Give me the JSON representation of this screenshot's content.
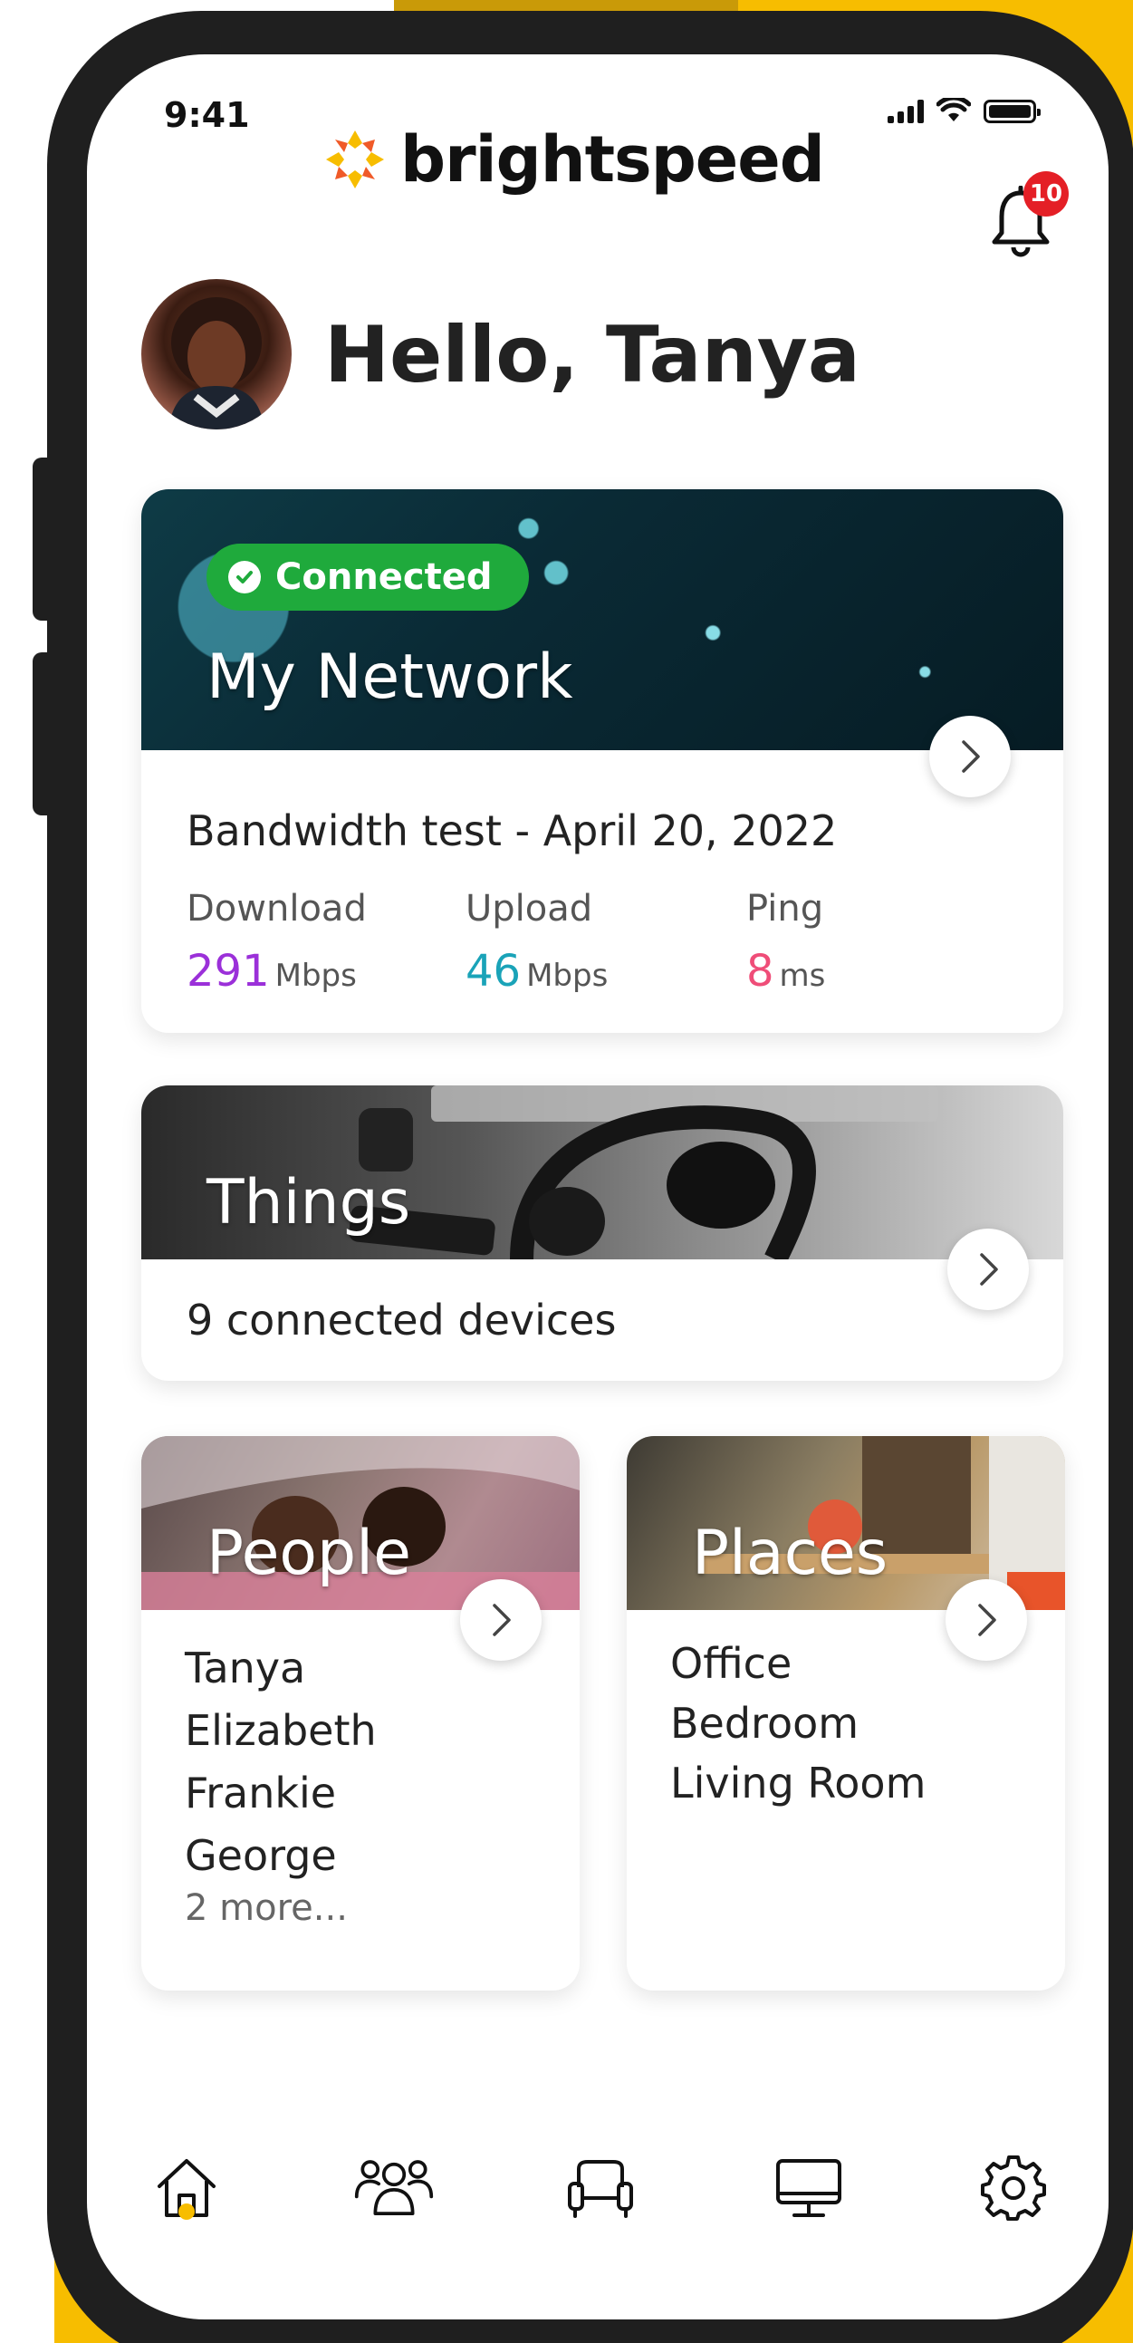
{
  "status_bar": {
    "time": "9:41"
  },
  "brand": {
    "name": "brightspeed",
    "colors": {
      "accent": "#f7bd00",
      "logo_red": "#f05a28"
    }
  },
  "notifications": {
    "count": "10",
    "icon": "bell-icon"
  },
  "greeting": {
    "text": "Hello, Tanya"
  },
  "network_card": {
    "status": "Connected",
    "title": "My Network",
    "test_title": "Bandwidth test - April 20, 2022",
    "stats": [
      {
        "label": "Download",
        "value": "291",
        "unit": "Mbps",
        "color": "#9b30d9"
      },
      {
        "label": "Upload",
        "value": "46",
        "unit": "Mbps",
        "color": "#1aa3b8"
      },
      {
        "label": "Ping",
        "value": "8",
        "unit": "ms",
        "color": "#ef4d78"
      }
    ]
  },
  "things_card": {
    "title": "Things",
    "subtitle": "9 connected devices"
  },
  "people_card": {
    "title": "People",
    "items": [
      "Tanya",
      "Elizabeth",
      "Frankie",
      "George"
    ],
    "more": "2 more..."
  },
  "places_card": {
    "title": "Places",
    "items": [
      "Office",
      "Bedroom",
      "Living Room"
    ]
  },
  "bottom_nav": {
    "active": "home",
    "items": [
      {
        "id": "home",
        "icon": "home-icon"
      },
      {
        "id": "people",
        "icon": "people-icon"
      },
      {
        "id": "places",
        "icon": "sofa-icon"
      },
      {
        "id": "things",
        "icon": "monitor-icon"
      },
      {
        "id": "settings",
        "icon": "gear-icon"
      }
    ]
  }
}
